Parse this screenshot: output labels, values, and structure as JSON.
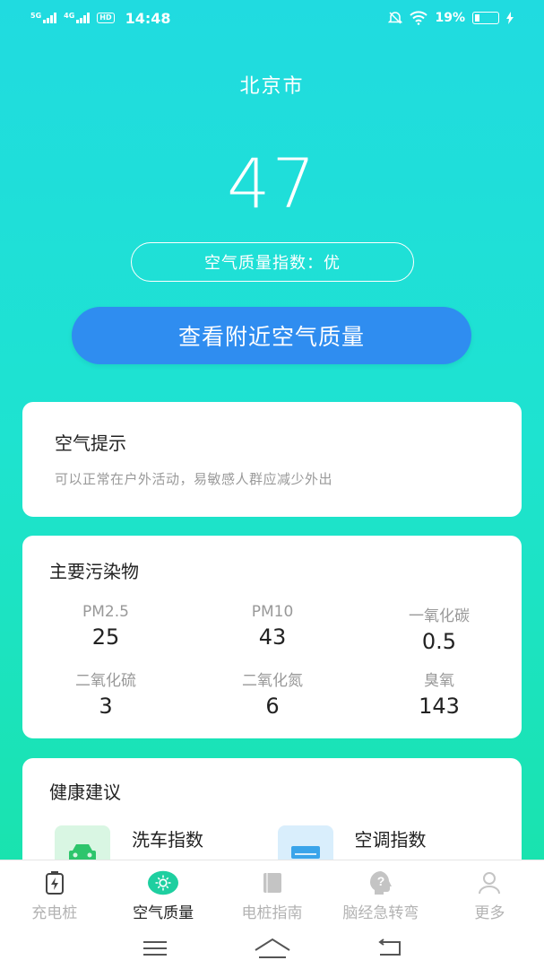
{
  "status_bar": {
    "net1": "5G",
    "net2": "4G",
    "hd": "HD",
    "time": "14:48",
    "battery": "19%",
    "battery_level": 0.19
  },
  "city": "北京市",
  "aqi_value": "47",
  "aqi_label": "空气质量指数：优",
  "nearby_button": "查看附近空气质量",
  "tip_card": {
    "title": "空气提示",
    "text": "可以正常在户外活动，易敏感人群应减少外出"
  },
  "pollutant_card": {
    "title": "主要污染物",
    "items": [
      {
        "name": "PM2.5",
        "value": "25"
      },
      {
        "name": "PM10",
        "value": "43"
      },
      {
        "name": "一氧化碳",
        "value": "0.5"
      },
      {
        "name": "二氧化硫",
        "value": "3"
      },
      {
        "name": "二氧化氮",
        "value": "6"
      },
      {
        "name": "臭氧",
        "value": "143"
      }
    ]
  },
  "health_card": {
    "title": "健康建议",
    "items": [
      {
        "label": "洗车指数",
        "icon": "car-icon",
        "color": "#2ec56c",
        "bg": "#d9f6e3"
      },
      {
        "label": "空调指数",
        "icon": "air-conditioner-icon",
        "color": "#3aa4ea",
        "bg": "#d9eefc"
      }
    ]
  },
  "tabs": [
    {
      "label": "充电桩",
      "icon": "charging-pile-icon",
      "active": false
    },
    {
      "label": "空气质量",
      "icon": "air-quality-icon",
      "active": true
    },
    {
      "label": "电桩指南",
      "icon": "book-icon",
      "active": false
    },
    {
      "label": "脑经急转弯",
      "icon": "question-head-icon",
      "active": false
    },
    {
      "label": "更多",
      "icon": "user-icon",
      "active": false
    }
  ],
  "colors": {
    "accent_button": "#2f8df0",
    "active_tab": "#1ecfa0",
    "inactive_tab": "#b3b3b3"
  }
}
